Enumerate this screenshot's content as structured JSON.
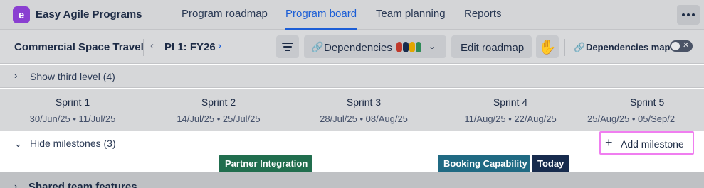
{
  "app": {
    "logo_letter": "e",
    "name": "Easy Agile Programs"
  },
  "nav": {
    "tabs": [
      {
        "label": "Program roadmap",
        "active": false
      },
      {
        "label": "Program board",
        "active": true
      },
      {
        "label": "Team planning",
        "active": false
      },
      {
        "label": "Reports",
        "active": false
      }
    ],
    "more_icon": "ellipsis-icon"
  },
  "toolbar": {
    "project": "Commercial Space Travel",
    "pi_prev_icon": "chevron-left-icon",
    "pi_label": "PI 1: FY26",
    "pi_next_icon": "chevron-right-icon",
    "filter_icon": "filter-icon",
    "dependencies_label": "Dependencies",
    "dependency_colors": [
      "#c0392b",
      "#172b4d",
      "#e2a600",
      "#2e8b57"
    ],
    "edit_roadmap_label": "Edit roadmap",
    "hand_icon": "hand-icon",
    "dependencies_map_label": "Dependencies map",
    "dependencies_map_on": false
  },
  "third_level": {
    "label": "Show third level (4)"
  },
  "sprints": [
    {
      "name": "Sprint 1",
      "dates": "30/Jun/25 • 11/Jul/25"
    },
    {
      "name": "Sprint 2",
      "dates": "14/Jul/25 • 25/Jul/25"
    },
    {
      "name": "Sprint 3",
      "dates": "28/Jul/25 • 08/Aug/25"
    },
    {
      "name": "Sprint 4",
      "dates": "11/Aug/25 • 22/Aug/25"
    },
    {
      "name": "Sprint 5",
      "dates": "25/Aug/25 • 05/Sep/2"
    }
  ],
  "milestones": {
    "label": "Hide milestones (3)",
    "add_label": "Add milestone",
    "items": [
      {
        "label": "Partner Integration",
        "color": "#216e4e"
      },
      {
        "label": "Booking Capability",
        "color": "#206a83"
      },
      {
        "label": "Today",
        "color": "#172b4d"
      }
    ]
  },
  "bottom_row": {
    "label": "Shared team features"
  }
}
